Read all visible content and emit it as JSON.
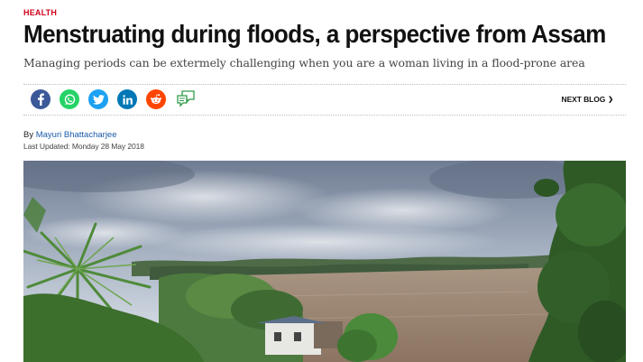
{
  "article": {
    "category": "HEALTH",
    "title": "Menstruating during floods, a perspective from Assam",
    "subtitle": "Managing periods can be extermely challenging when you are a woman living in a flood-prone area",
    "byline_prefix": "By",
    "author": "Mayuri Bhattacharjee",
    "last_updated": "Last Updated: Monday 28 May 2018"
  },
  "share": {
    "icons": [
      "facebook-icon",
      "whatsapp-icon",
      "twitter-icon",
      "linkedin-icon",
      "reddit-icon",
      "comment-icon"
    ],
    "colors": {
      "facebook": "#3b5998",
      "whatsapp": "#25d366",
      "twitter": "#1da1f2",
      "linkedin": "#0077b5",
      "reddit": "#ff4500",
      "comment": "#2e9b47"
    }
  },
  "nav": {
    "next_blog_label": "NEXT BLOG",
    "next_blog_arrow": "❯"
  },
  "colors": {
    "category": "#d0021b",
    "author_link": "#1a5aa8"
  }
}
